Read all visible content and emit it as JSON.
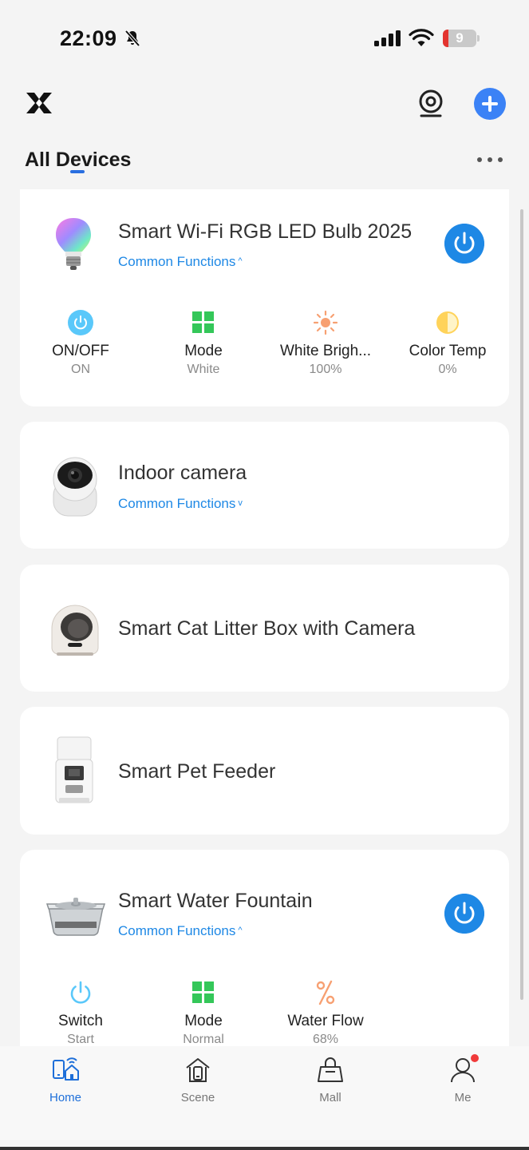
{
  "status_bar": {
    "time": "22:09",
    "battery": "9"
  },
  "header": {
    "title": "All Devices"
  },
  "devices": [
    {
      "name": "Smart Wi-Fi RGB LED Bulb 2025",
      "common_functions": "Common Functions",
      "functions": [
        {
          "label": "ON/OFF",
          "value": "ON",
          "icon": "power-icon"
        },
        {
          "label": "Mode",
          "value": "White",
          "icon": "grid-icon"
        },
        {
          "label": "White Brigh...",
          "value": "100%",
          "icon": "sun-icon"
        },
        {
          "label": "Color Temp",
          "value": "0%",
          "icon": "contrast-icon"
        }
      ]
    },
    {
      "name": "Indoor camera",
      "common_functions": "Common Functions"
    },
    {
      "name": "Smart Cat Litter Box with Camera"
    },
    {
      "name": "Smart Pet Feeder"
    },
    {
      "name": "Smart Water Fountain",
      "common_functions": "Common Functions",
      "functions": [
        {
          "label": "Switch",
          "value": "Start",
          "icon": "power-icon"
        },
        {
          "label": "Mode",
          "value": "Normal",
          "icon": "grid-icon"
        },
        {
          "label": "Water Flow",
          "value": "68%",
          "icon": "percent-icon"
        }
      ]
    }
  ],
  "tabbar": [
    {
      "label": "Home",
      "icon": "home-icon",
      "active": true
    },
    {
      "label": "Scene",
      "icon": "scene-icon"
    },
    {
      "label": "Mall",
      "icon": "bag-icon"
    },
    {
      "label": "Me",
      "icon": "user-icon"
    }
  ],
  "colors": {
    "accent": "#1e88e5",
    "mode_green": "#34c759",
    "sun_orange": "#f7a072",
    "temp_yellow": "#ffd35a",
    "badge_red": "#f03a3a"
  }
}
